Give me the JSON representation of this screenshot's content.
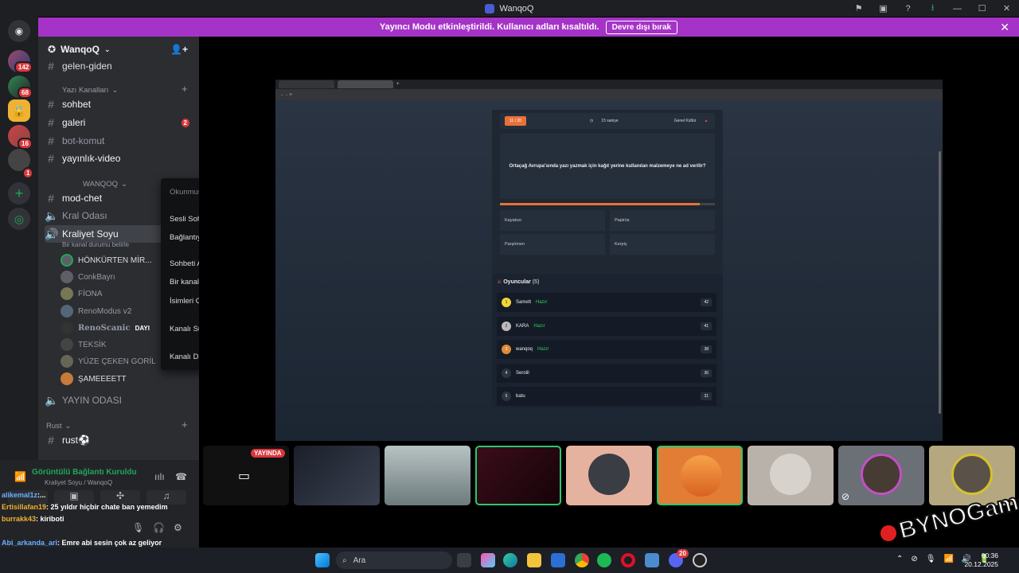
{
  "window": {
    "title": "WanqoQ"
  },
  "streamer_banner": {
    "text": "Yayıncı Modu etkinleştirildi. Kullanıcı adları kısaltıldı.",
    "button": "Devre dışı bırak"
  },
  "server_badges": [
    "142",
    "68",
    "16",
    "1"
  ],
  "guild": {
    "name": "WanqoQ"
  },
  "channels": {
    "gelen_giden": "gelen-giden",
    "cat_text": "Yazı Kanalları",
    "sohbet": "sohbet",
    "galeri": "galeri",
    "galeri_badge": "2",
    "bot_komut": "bot-komut",
    "yayinlik": "yayınlık-video",
    "cat_wanqoq": "WANQOQ",
    "mod_chet": "mod-chet",
    "kral_odasi": "Kral Odası",
    "kraliyet": "Kraliyet Soyu",
    "kraliyet_status": "Bir kanal durumu belirle",
    "yayin_odasi": "YAYIN ODASI",
    "cat_rust": "Rust",
    "rust": "rust⚽"
  },
  "voice_users": [
    "HÖNKÜRTEN MİR...",
    "ConkBayrı",
    "FİONA",
    "RenoModus v2",
    "RenoScanic",
    "TEKSİK",
    "YÜZE ÇEKEN GORİL",
    "ŞAMEEEETT"
  ],
  "dayi_tag": "DAYI",
  "voice_panel": {
    "status": "Görüntülü Bağlantı Kuruldu",
    "channel": "Kraliyet Soyu / WanqoQ"
  },
  "context_menu": {
    "mark_read": "Okunmuş Olarak İşaretle",
    "invite": "Sesli Sohbete Davet et",
    "copy_link": "Bağlantıyı Kopyala",
    "open_chat": "Sohbeti Aç",
    "set_status": "Bir kanal durumu belirle",
    "hide_names": "İsimleri Gizle",
    "mute": "Kanalı Sustur",
    "edit": "Kanalı Düzenle"
  },
  "quiz": {
    "counter": "11 / 20",
    "timer": "15 saniye",
    "category": "Genel Kültür",
    "question": "Ortaçağ Avrupa'sında yazı yazmak için kağıt yerine kullanılan malzemeye ne ad verilir?",
    "timer_fill": 0.93,
    "answers": [
      "Kayatozı",
      "Papirüs",
      "Parşömen",
      "Kerpiç"
    ],
    "players_title": "Oyuncular",
    "players_count": "(5)",
    "players": [
      {
        "rank": "1",
        "name": "Samett",
        "score": "42",
        "status": "Hazır"
      },
      {
        "rank": "2",
        "name": "KARA",
        "score": "41",
        "status": "Hazır"
      },
      {
        "rank": "3",
        "name": "wanqoq",
        "score": "38",
        "status": "Hazır"
      },
      {
        "rank": "4",
        "name": "Serolil",
        "score": "36",
        "status": ""
      },
      {
        "rank": "5",
        "name": "batu",
        "score": "31",
        "status": ""
      }
    ]
  },
  "live_badge": "YAYINDA",
  "chat": [
    {
      "user": "alikemal1z",
      "text": ":..."
    },
    {
      "user": "Ertisillafan19",
      "text": ": 25 yıldır hiçbir chate ban yemedim"
    },
    {
      "user": "burrakk43",
      "text": ": kiriboti"
    },
    {
      "user": "Abi_arkanda_ari",
      "text": ": Emre abi sesin çok az geliyor"
    }
  ],
  "overlay_logo": "BYNOGame",
  "taskbar": {
    "search": "Ara",
    "time": "00:36",
    "date": "20.12.2025",
    "discord_badge": "20"
  }
}
